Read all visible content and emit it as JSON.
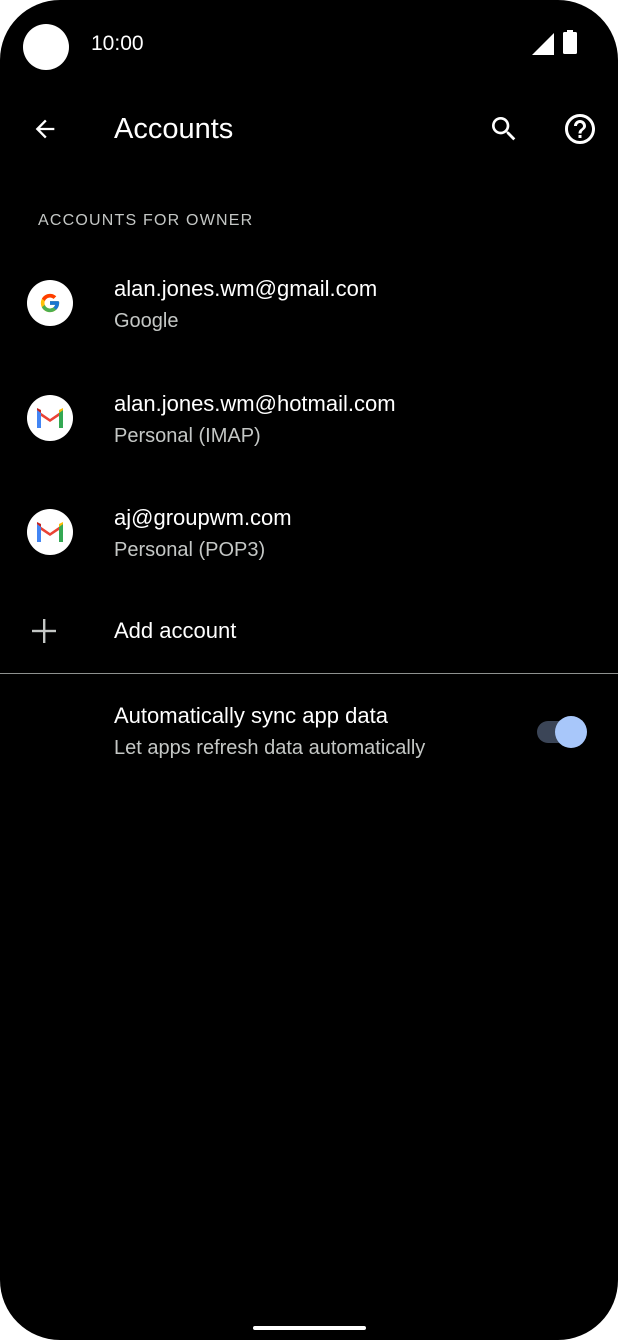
{
  "status_bar": {
    "time": "10:00"
  },
  "app_bar": {
    "title": "Accounts",
    "back_icon": "arrow-left-icon",
    "search_icon": "search-icon",
    "help_icon": "help-circle-icon"
  },
  "section": {
    "header": "ACCOUNTS FOR OWNER"
  },
  "accounts": [
    {
      "email": "alan.jones.wm@gmail.com",
      "type": "Google",
      "icon": "google-g-icon"
    },
    {
      "email": "alan.jones.wm@hotmail.com",
      "type": "Personal (IMAP)",
      "icon": "gmail-m-icon"
    },
    {
      "email": "aj@groupwm.com",
      "type": "Personal (POP3)",
      "icon": "gmail-m-icon"
    }
  ],
  "add_account": {
    "label": "Add account",
    "icon": "plus-icon"
  },
  "sync": {
    "title": "Automatically sync app data",
    "summary": "Let apps refresh data automatically",
    "enabled": true
  },
  "colors": {
    "background": "#000000",
    "primary_text": "#ffffff",
    "secondary_text": "#c4c7c5",
    "toggle_thumb": "#a8c7fa",
    "toggle_track": "#3b4557",
    "divider": "#8e918f"
  }
}
